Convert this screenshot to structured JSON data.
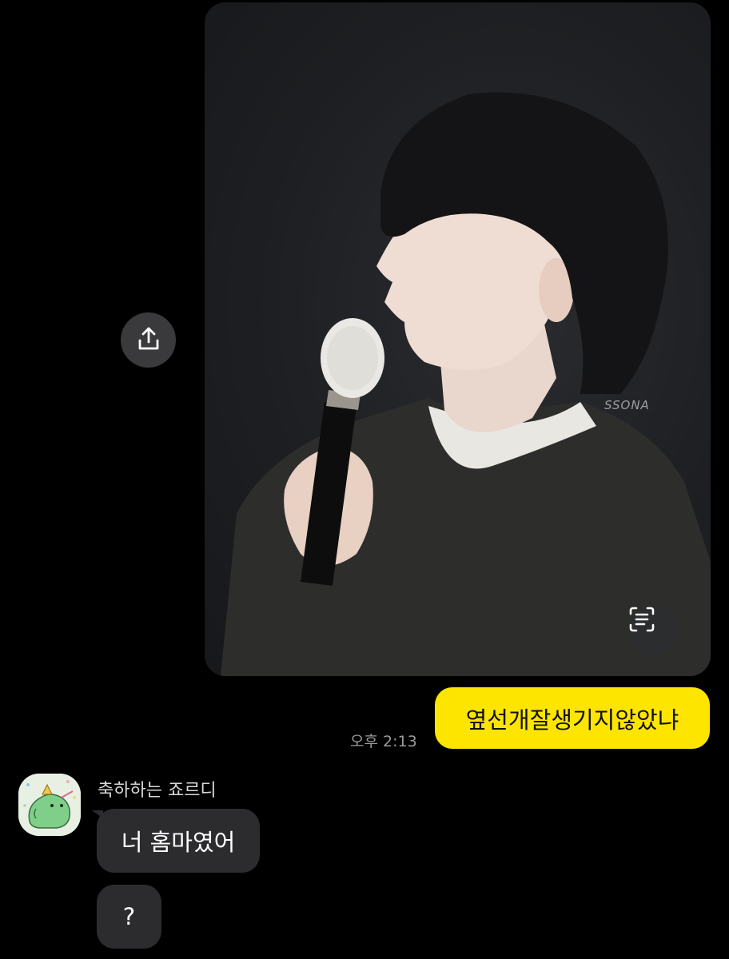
{
  "chat": {
    "messages": [
      {
        "id": "photo",
        "direction": "outgoing",
        "type": "image",
        "watermark": "SSONA"
      },
      {
        "id": "sent-text",
        "direction": "outgoing",
        "type": "text",
        "text": "옆선개잘생기지않았냐",
        "time": "오후 2:13"
      }
    ],
    "incoming": {
      "sender_name": "축하하는 죠르디",
      "messages": [
        {
          "text": "너 홈마였어"
        },
        {
          "text": "?"
        }
      ]
    }
  },
  "icons": {
    "share": "share-icon",
    "text-scan": "text-scan-icon",
    "avatar": "dinosaur-avatar"
  },
  "colors": {
    "background": "#000000",
    "sent_bubble": "#fee500",
    "received_bubble": "#2c2c2e",
    "timestamp": "#9a9a9a"
  }
}
